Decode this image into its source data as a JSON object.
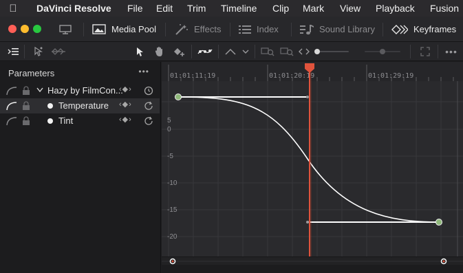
{
  "menubar": {
    "app_name": "DaVinci Resolve",
    "items": [
      "File",
      "Edit",
      "Trim",
      "Timeline",
      "Clip",
      "Mark",
      "View",
      "Playback",
      "Fusion"
    ]
  },
  "toolbar": {
    "media_pool": "Media Pool",
    "effects": "Effects",
    "index": "Index",
    "sound_library": "Sound Library",
    "keyframes": "Keyframes"
  },
  "params": {
    "title": "Parameters",
    "rows": [
      {
        "label": "Hazy by FilmCon..."
      },
      {
        "label": "Temperature"
      },
      {
        "label": "Tint"
      }
    ]
  },
  "graph": {
    "timecodes": [
      "01:01:11:19",
      "01:01:20:19",
      "01:01:29:19"
    ],
    "y_labels": [
      "5",
      "0",
      "-5",
      "-10",
      "-15",
      "-20"
    ],
    "keyframes": [
      {
        "time": "01:01:11:19",
        "value": 5.8
      },
      {
        "time": "01:01:33:19",
        "value": -17
      }
    ],
    "playhead": "01:01:21:10"
  },
  "colors": {
    "playhead": "#e0533c",
    "keyframe": "#8fb87a",
    "curve": "#ffffff"
  }
}
